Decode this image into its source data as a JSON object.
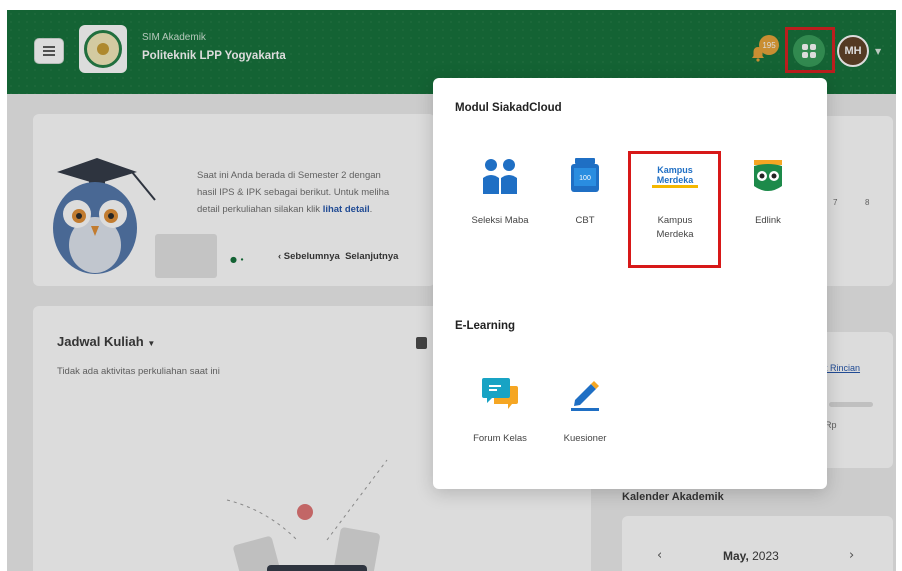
{
  "header": {
    "app_subtitle": "SIM Akademik",
    "app_title": "Politeknik LPP Yogyakarta",
    "notification_count": "195",
    "user_initials": "MH"
  },
  "hero": {
    "line1": "Saat ini Anda berada di Semester 2 dengan",
    "line2": "hasil IPS & IPK sebagai berikut. Untuk meliha",
    "line3_prefix": "detail perkuliahan silakan klik ",
    "line3_link": "lihat detail",
    "line3_suffix": ".",
    "prev_label": "‹ Sebelumnya",
    "next_label": "Selanjutnya",
    "right_nums": [
      "7",
      "8"
    ]
  },
  "jadwal": {
    "title": "Jadwal Kuliah",
    "empty_text": "Tidak ada aktivitas perkuliahan saat ini"
  },
  "keuangan": {
    "link_text": "t Rincian",
    "currency": "Rp"
  },
  "kalender": {
    "title": "Kalender Akademik",
    "month": "May,",
    "year": " 2023",
    "prev": "‹",
    "next": "›"
  },
  "dropdown": {
    "section1_title": "Modul SiakadCloud",
    "section1_items": [
      {
        "label": "Seleksi Maba",
        "icon": "users-icon"
      },
      {
        "label": "CBT",
        "icon": "cbt-icon"
      },
      {
        "label": "Kampus Merdeka",
        "icon": "kampus-merdeka-logo"
      },
      {
        "label": "Edlink",
        "icon": "edlink-owl-icon"
      }
    ],
    "section2_title": "E-Learning",
    "section2_items": [
      {
        "label": "Forum Kelas",
        "icon": "chat-icon"
      },
      {
        "label": "Kuesioner",
        "icon": "pencil-icon"
      }
    ],
    "cbt_text": "100",
    "kampus_logo_line1": "Kampus",
    "kampus_logo_line2": "Merdeka"
  },
  "colors": {
    "brand_green": "#0c6c32",
    "highlight_red": "#d71818",
    "badge_orange": "#e8a030",
    "link_blue": "#1b4fa8"
  }
}
